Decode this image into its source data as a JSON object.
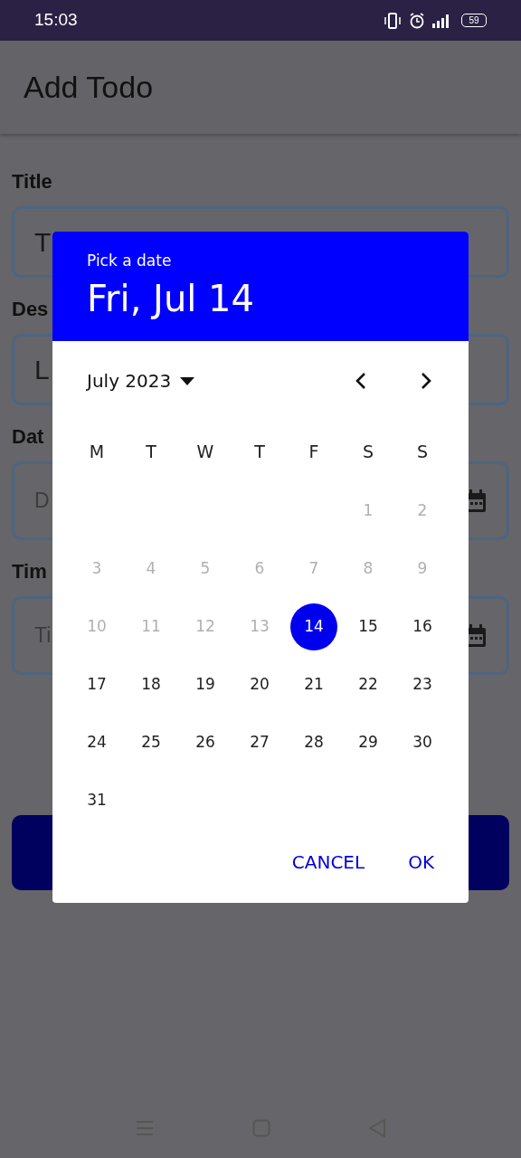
{
  "status_bar": {
    "time": "15:03",
    "battery": "59"
  },
  "app_bar": {
    "title": "Add Todo"
  },
  "form": {
    "fields": [
      {
        "label": "Title",
        "value": "T",
        "kind": "text"
      },
      {
        "label": "Des",
        "value": "L",
        "kind": "text"
      },
      {
        "label": "Dat",
        "placeholder": "D",
        "kind": "date"
      },
      {
        "label": "Tim",
        "placeholder": "Ti",
        "kind": "time"
      }
    ]
  },
  "dialog": {
    "subtitle": "Pick a date",
    "headline": "Fri, Jul 14",
    "month": "July 2023",
    "weekdays": [
      "M",
      "T",
      "W",
      "T",
      "F",
      "S",
      "S"
    ],
    "weeks": [
      [
        {
          "kind": "empty"
        },
        {
          "kind": "empty"
        },
        {
          "kind": "empty"
        },
        {
          "kind": "empty"
        },
        {
          "kind": "empty"
        },
        {
          "kind": "day",
          "label": "1",
          "disabled": true,
          "selected": false
        },
        {
          "kind": "day",
          "label": "2",
          "disabled": true,
          "selected": false
        }
      ],
      [
        {
          "kind": "day",
          "label": "3",
          "disabled": true,
          "selected": false
        },
        {
          "kind": "day",
          "label": "4",
          "disabled": true,
          "selected": false
        },
        {
          "kind": "day",
          "label": "5",
          "disabled": true,
          "selected": false
        },
        {
          "kind": "day",
          "label": "6",
          "disabled": true,
          "selected": false
        },
        {
          "kind": "day",
          "label": "7",
          "disabled": true,
          "selected": false
        },
        {
          "kind": "day",
          "label": "8",
          "disabled": true,
          "selected": false
        },
        {
          "kind": "day",
          "label": "9",
          "disabled": true,
          "selected": false
        }
      ],
      [
        {
          "kind": "day",
          "label": "10",
          "disabled": true,
          "selected": false
        },
        {
          "kind": "day",
          "label": "11",
          "disabled": true,
          "selected": false
        },
        {
          "kind": "day",
          "label": "12",
          "disabled": true,
          "selected": false
        },
        {
          "kind": "day",
          "label": "13",
          "disabled": true,
          "selected": false
        },
        {
          "kind": "day",
          "label": "14",
          "disabled": false,
          "selected": true
        },
        {
          "kind": "day",
          "label": "15",
          "disabled": false,
          "selected": false
        },
        {
          "kind": "day",
          "label": "16",
          "disabled": false,
          "selected": false
        }
      ],
      [
        {
          "kind": "day",
          "label": "17",
          "disabled": false,
          "selected": false
        },
        {
          "kind": "day",
          "label": "18",
          "disabled": false,
          "selected": false
        },
        {
          "kind": "day",
          "label": "19",
          "disabled": false,
          "selected": false
        },
        {
          "kind": "day",
          "label": "20",
          "disabled": false,
          "selected": false
        },
        {
          "kind": "day",
          "label": "21",
          "disabled": false,
          "selected": false
        },
        {
          "kind": "day",
          "label": "22",
          "disabled": false,
          "selected": false
        },
        {
          "kind": "day",
          "label": "23",
          "disabled": false,
          "selected": false
        }
      ],
      [
        {
          "kind": "day",
          "label": "24",
          "disabled": false,
          "selected": false
        },
        {
          "kind": "day",
          "label": "25",
          "disabled": false,
          "selected": false
        },
        {
          "kind": "day",
          "label": "26",
          "disabled": false,
          "selected": false
        },
        {
          "kind": "day",
          "label": "27",
          "disabled": false,
          "selected": false
        },
        {
          "kind": "day",
          "label": "28",
          "disabled": false,
          "selected": false
        },
        {
          "kind": "day",
          "label": "29",
          "disabled": false,
          "selected": false
        },
        {
          "kind": "day",
          "label": "30",
          "disabled": false,
          "selected": false
        }
      ],
      [
        {
          "kind": "day",
          "label": "31",
          "disabled": false,
          "selected": false
        }
      ]
    ],
    "buttons": [
      "CANCEL",
      "OK"
    ]
  }
}
